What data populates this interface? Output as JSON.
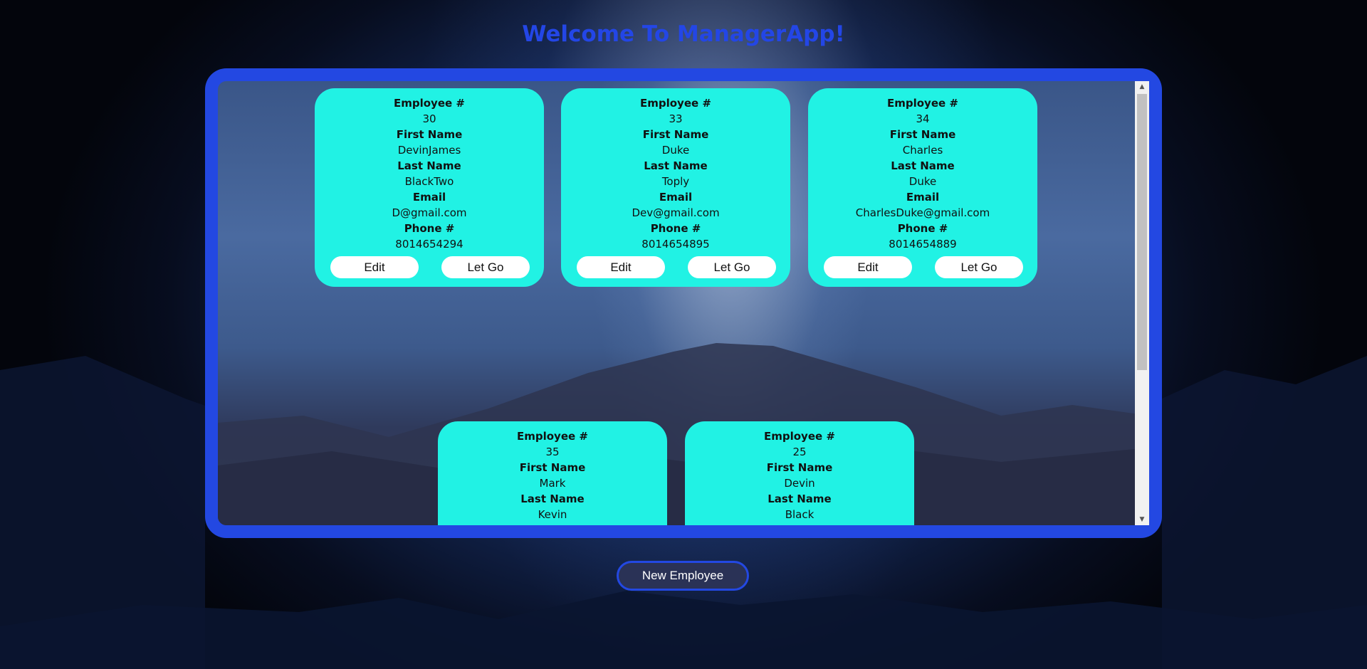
{
  "page": {
    "title": "Welcome To ManagerApp!",
    "new_employee_label": "New Employee"
  },
  "labels": {
    "employee_no": "Employee #",
    "first_name": "First Name",
    "last_name": "Last Name",
    "email": "Email",
    "phone": "Phone #",
    "edit": "Edit",
    "let_go": "Let Go"
  },
  "employees": [
    {
      "id": "30",
      "first_name": "DevinJames",
      "last_name": "BlackTwo",
      "email": "D@gmail.com",
      "phone": "8014654294"
    },
    {
      "id": "33",
      "first_name": "Duke",
      "last_name": "Toply",
      "email": "Dev@gmail.com",
      "phone": "8014654895"
    },
    {
      "id": "34",
      "first_name": "Charles",
      "last_name": "Duke",
      "email": "CharlesDuke@gmail.com",
      "phone": "8014654889"
    },
    {
      "id": "35",
      "first_name": "Mark",
      "last_name": "Kevin"
    },
    {
      "id": "25",
      "first_name": "Devin",
      "last_name": "Black"
    }
  ],
  "colors": {
    "title": "#2346e6",
    "frame": "#2348e2",
    "card": "#21f2e4",
    "button_bg": "#ffffff",
    "new_button_bg": "#2a3256"
  },
  "icons": {
    "scroll_up": "▲",
    "scroll_down": "▼"
  }
}
